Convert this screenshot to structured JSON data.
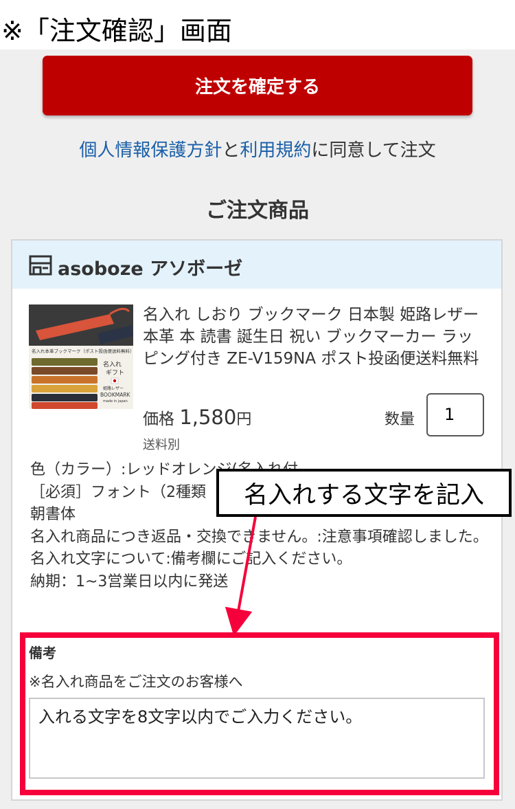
{
  "header": {
    "title": "※「注文確認」画面"
  },
  "confirm_button": {
    "label": "注文を確定する"
  },
  "agreement": {
    "privacy_link": "個人情報保護方針",
    "conj": "と",
    "terms_link": "利用規約",
    "suffix": "に同意して注文"
  },
  "section_title": "ご注文商品",
  "shop": {
    "name": "asoboze アソボーゼ",
    "icon": "store-icon"
  },
  "product": {
    "thumbnail": {
      "banner_text": "名入れ本革ブックマーク（ポスト投函便送料無料）",
      "label_line1": "名入れ",
      "label_line2": "ギフト",
      "label_line3": "姫路レザー",
      "brand": "BOOKMARK",
      "made_in": "made in japan"
    },
    "name": "名入れ しおり ブックマーク 日本製 姫路レザー 本革 本 読書 誕生日 祝い ブックマーカー ラッピング付き ZE-V159NA ポスト投函便送料無料",
    "price_label": "価格",
    "price": "1,580",
    "currency": "円",
    "shipping": "送料別",
    "qty_label": "数量",
    "qty_value": "1"
  },
  "options": [
    "色（カラー）:レッドオレンジ(名入れ付",
    "［必須］フォント（2種類",
    "朝書体",
    "名入れ商品につき返品・交換できません。:注意事項確認しました。",
    "名入れ文字について:備考欄にご記入ください。",
    "納期：1~3営業日以内に発送"
  ],
  "remarks": {
    "title": "備考",
    "note": "※名入れ商品をご注文のお客様へ",
    "value": "入れる文字を8文字以内でご入力ください。"
  },
  "annotation": {
    "callout_text": "名入れする文字を記入",
    "highlight_color": "#f5003a",
    "arrow_color": "#f5003a"
  }
}
